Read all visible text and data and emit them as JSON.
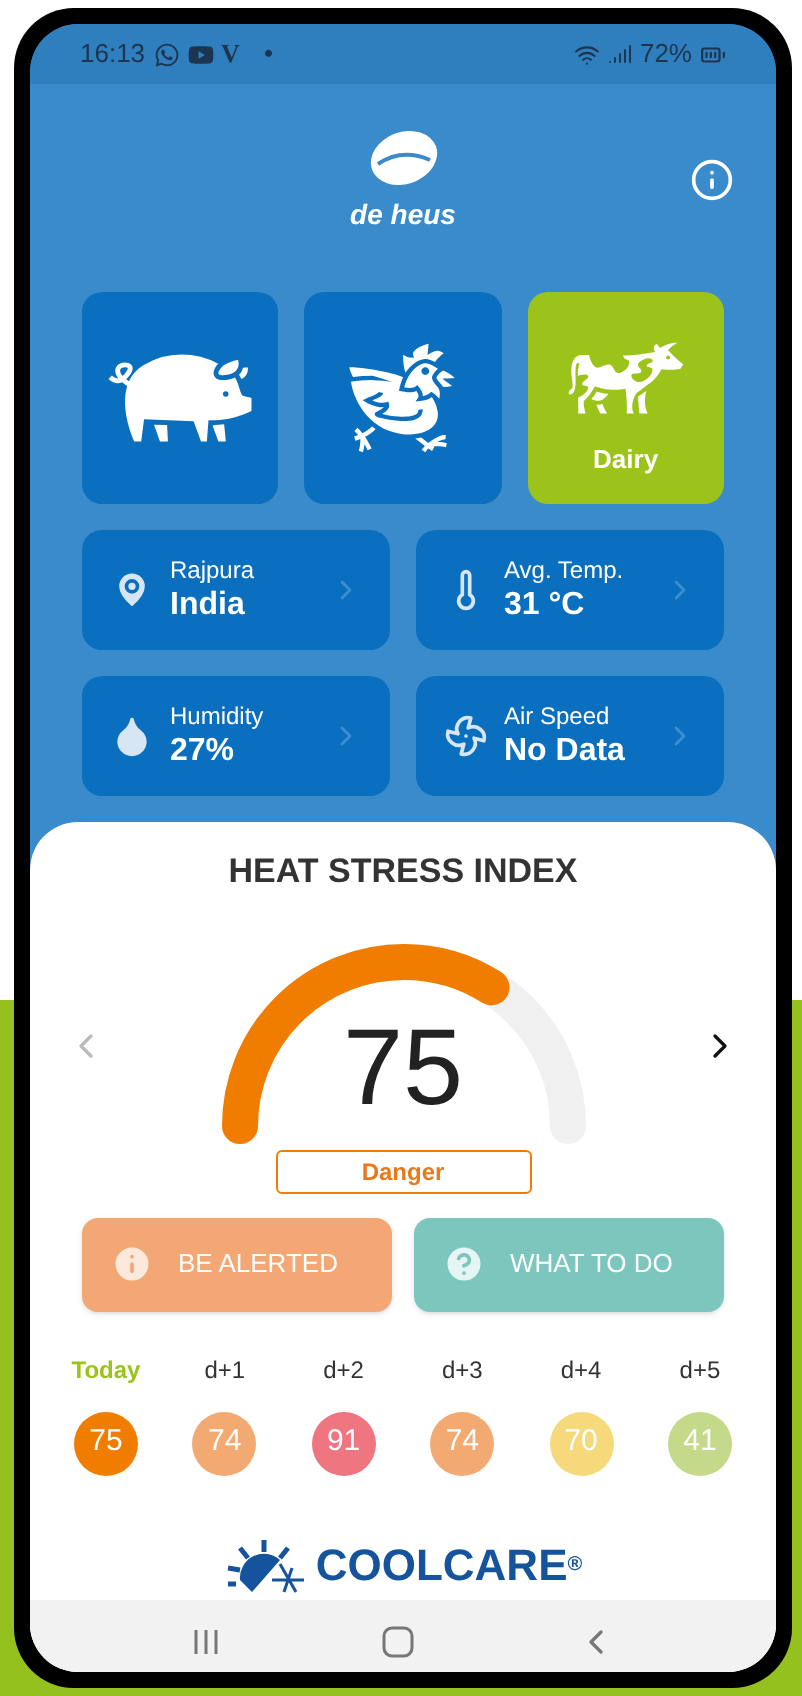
{
  "status_bar": {
    "time": "16:13",
    "app_letter": "V",
    "dot": "•",
    "battery": "72%"
  },
  "header": {
    "logo_text": "de heus"
  },
  "species": [
    {
      "kind": "pig",
      "selected": false
    },
    {
      "kind": "chicken",
      "selected": false
    },
    {
      "kind": "cow",
      "selected": true,
      "label": "Dairy"
    }
  ],
  "info_cards": [
    {
      "kind": "location",
      "label": "Rajpura",
      "value": "India"
    },
    {
      "kind": "temperature",
      "label": "Avg. Temp.",
      "value": "31 °C"
    },
    {
      "kind": "humidity",
      "label": "Humidity",
      "value": "27%"
    },
    {
      "kind": "air",
      "label": "Air Speed",
      "value": "No Data"
    }
  ],
  "heat_stress": {
    "title": "HEAT STRESS INDEX",
    "value": "75",
    "status": "Danger"
  },
  "actions": [
    {
      "kind": "alert",
      "label": "BE ALERTED"
    },
    {
      "kind": "help",
      "label": "WHAT TO DO"
    }
  ],
  "forecast": [
    {
      "day": "Today",
      "value": "75",
      "color": "#f07d00",
      "selected": true
    },
    {
      "day": "d+1",
      "value": "74",
      "color": "#f2aa72",
      "selected": false
    },
    {
      "day": "d+2",
      "value": "91",
      "color": "#ef7680",
      "selected": false
    },
    {
      "day": "d+3",
      "value": "74",
      "color": "#f2aa72",
      "selected": false
    },
    {
      "day": "d+4",
      "value": "70",
      "color": "#f5d97a",
      "selected": false
    },
    {
      "day": "d+5",
      "value": "41",
      "color": "#c5d98a",
      "selected": false
    }
  ],
  "brand": {
    "name": "COOLCARE",
    "mark": "®"
  }
}
